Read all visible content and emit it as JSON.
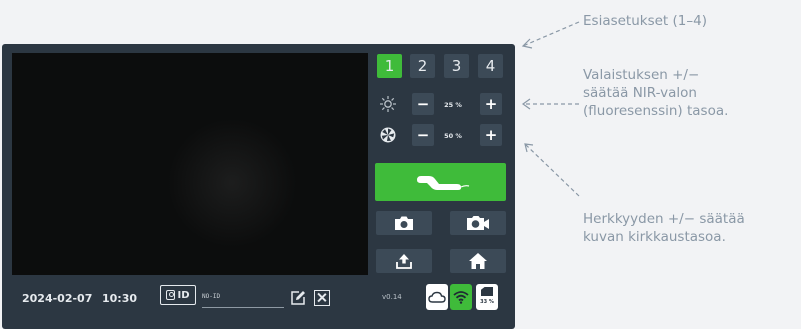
{
  "status": {
    "date": "2024-02-07",
    "time": "10:30",
    "id_label": "ID",
    "id_placeholder": "NO-ID",
    "version": "v0.14",
    "sd_percent": "33 %"
  },
  "presets": [
    "1",
    "2",
    "3",
    "4"
  ],
  "active_preset": "1",
  "lighting": {
    "minus": "−",
    "value": "25 %",
    "plus": "+"
  },
  "sensitivity": {
    "minus": "−",
    "value": "50 %",
    "plus": "+"
  },
  "callouts": {
    "presets": "Esiasetukset (1–4)",
    "lighting": [
      "Valaistuksen +/−",
      "säätää NIR-valon",
      "(fluoresenssin) tasoa."
    ],
    "sensitivity": [
      "Herkkyyden +/− säätää",
      "kuvan kirkkaustasoa."
    ]
  },
  "colors": {
    "panel": "#2c3742",
    "button": "#3c4a57",
    "accent_green": "#3fbb3a",
    "callout_text": "#8a98a6"
  },
  "icons": {
    "lighting": "sun-icon",
    "sensitivity": "aperture-icon",
    "capture": "probe-icon",
    "photo": "camera-icon",
    "video": "video-camera-icon",
    "upload": "upload-icon",
    "home": "home-icon",
    "cloud": "cloud-icon",
    "wifi": "wifi-icon",
    "sd": "sd-card-icon",
    "edit": "edit-icon",
    "clear": "clear-icon"
  }
}
